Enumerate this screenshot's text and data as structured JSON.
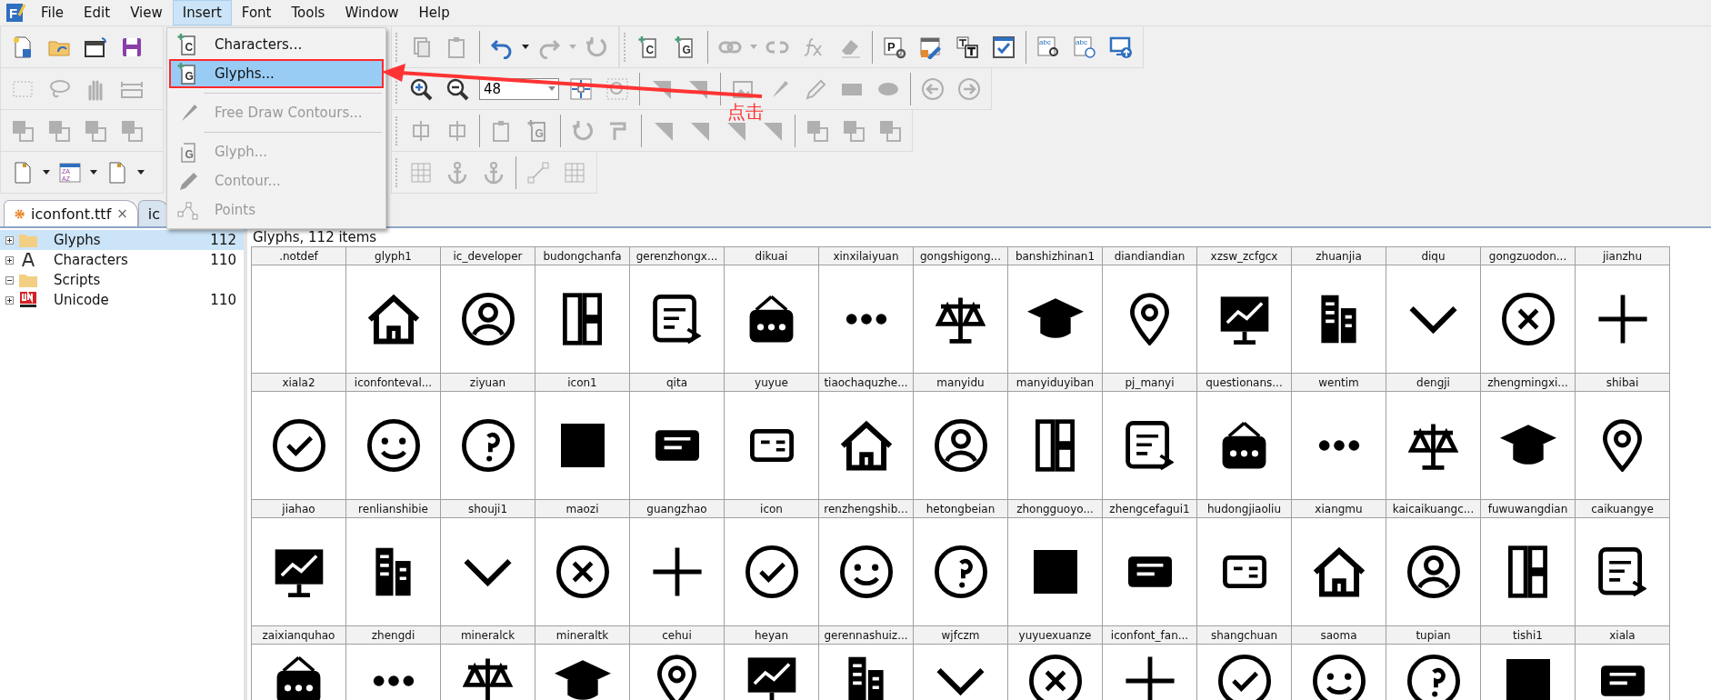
{
  "menu_bar": {
    "logo_letter": "F",
    "items": [
      {
        "label": "File",
        "selected": false
      },
      {
        "label": "Edit",
        "selected": false
      },
      {
        "label": "View",
        "selected": false
      },
      {
        "label": "Insert",
        "selected": true
      },
      {
        "label": "Font",
        "selected": false
      },
      {
        "label": "Tools",
        "selected": false
      },
      {
        "label": "Window",
        "selected": false
      },
      {
        "label": "Help",
        "selected": false
      }
    ]
  },
  "insert_menu": {
    "items": [
      {
        "kind": "add-char",
        "letter": "C",
        "label": "Characters...",
        "selected": false,
        "disabled": false,
        "outlined": false
      },
      {
        "kind": "add-glyph",
        "letter": "G",
        "label": "Glyphs...",
        "selected": true,
        "disabled": false,
        "outlined": true
      },
      {
        "kind": "separator"
      },
      {
        "kind": "draw",
        "label": "Free Draw Contours...",
        "selected": false,
        "disabled": true,
        "outlined": false
      },
      {
        "kind": "separator"
      },
      {
        "kind": "glyph",
        "letter": "G",
        "label": "Glyph...",
        "selected": false,
        "disabled": true,
        "outlined": false
      },
      {
        "kind": "contour",
        "label": "Contour...",
        "selected": false,
        "disabled": true,
        "outlined": false
      },
      {
        "kind": "points",
        "label": "Points",
        "selected": false,
        "disabled": true,
        "outlined": false
      }
    ]
  },
  "toolbars": [
    {
      "left": [
        {
          "kind": "new",
          "disabled": false
        },
        {
          "kind": "open",
          "disabled": false
        },
        {
          "kind": "font",
          "disabled": false
        },
        {
          "kind": "save",
          "disabled": false
        }
      ],
      "right": [
        {
          "kind": "copy",
          "disabled": true
        },
        {
          "kind": "paste",
          "disabled": true
        },
        {
          "kind": "sep"
        },
        {
          "kind": "undo",
          "disabled": false
        },
        {
          "kind": "caret",
          "disabled": false
        },
        {
          "kind": "redo",
          "disabled": true
        },
        {
          "kind": "caret",
          "disabled": true
        },
        {
          "kind": "reload",
          "disabled": true
        },
        {
          "kind": "strip"
        },
        {
          "kind": "add-char",
          "letter": "C",
          "disabled": false
        },
        {
          "kind": "add-glyph",
          "letter": "G",
          "disabled": false
        },
        {
          "kind": "sep"
        },
        {
          "kind": "link",
          "disabled": true
        },
        {
          "kind": "caret",
          "disabled": true
        },
        {
          "kind": "unlink",
          "disabled": true
        },
        {
          "kind": "fx",
          "disabled": true
        },
        {
          "kind": "eraser",
          "disabled": true
        },
        {
          "kind": "sep"
        },
        {
          "kind": "params",
          "letter": "P",
          "disabled": false
        },
        {
          "kind": "table",
          "disabled": false
        },
        {
          "kind": "text",
          "disabled": false
        },
        {
          "kind": "check",
          "disabled": false
        },
        {
          "kind": "sep"
        },
        {
          "kind": "spell",
          "letter": "abc",
          "disabled": false
        },
        {
          "kind": "web",
          "letter": "abc",
          "disabled": false
        },
        {
          "kind": "upload",
          "disabled": false
        }
      ]
    },
    {
      "left": [
        {
          "kind": "select",
          "disabled": true
        },
        {
          "kind": "lasso",
          "disabled": true
        },
        {
          "kind": "hand",
          "disabled": true
        },
        {
          "kind": "ruler",
          "disabled": true
        }
      ],
      "right": [
        {
          "kind": "zoom-in",
          "disabled": false
        },
        {
          "kind": "zoom-out",
          "disabled": false
        },
        {
          "kind": "zoom",
          "value": "48"
        },
        {
          "kind": "fit",
          "disabled": false
        },
        {
          "kind": "zoom-rect",
          "disabled": true
        },
        {
          "kind": "sep"
        },
        {
          "kind": "triangle",
          "disabled": true
        },
        {
          "kind": "triangle",
          "disabled": true
        },
        {
          "kind": "sep"
        },
        {
          "kind": "image",
          "disabled": true
        },
        {
          "kind": "brush",
          "disabled": true
        },
        {
          "kind": "pencil",
          "disabled": true
        },
        {
          "kind": "rectangle",
          "disabled": true
        },
        {
          "kind": "ellipse",
          "disabled": true
        },
        {
          "kind": "sep"
        },
        {
          "kind": "prev",
          "disabled": true
        },
        {
          "kind": "next",
          "disabled": true
        }
      ]
    },
    {
      "left": [
        {
          "kind": "overlap",
          "disabled": true
        },
        {
          "kind": "overlap",
          "disabled": true
        },
        {
          "kind": "overlap",
          "disabled": true
        },
        {
          "kind": "overlap",
          "disabled": true
        }
      ],
      "right": [
        {
          "kind": "align",
          "disabled": true
        },
        {
          "kind": "align",
          "disabled": true
        },
        {
          "kind": "sep"
        },
        {
          "kind": "paste",
          "disabled": true
        },
        {
          "kind": "add-glyph",
          "letter": "G",
          "disabled": true
        },
        {
          "kind": "sep"
        },
        {
          "kind": "reload",
          "disabled": true
        },
        {
          "kind": "clamp",
          "disabled": true
        },
        {
          "kind": "sep"
        },
        {
          "kind": "triangle",
          "disabled": true
        },
        {
          "kind": "triangle",
          "disabled": true
        },
        {
          "kind": "triangle",
          "disabled": true
        },
        {
          "kind": "triangle",
          "disabled": true
        },
        {
          "kind": "sep"
        },
        {
          "kind": "overlap",
          "disabled": true
        },
        {
          "kind": "overlap",
          "disabled": true
        },
        {
          "kind": "overlap",
          "disabled": true
        }
      ]
    },
    {
      "left": [
        {
          "kind": "page",
          "disabled": false
        },
        {
          "kind": "caret",
          "disabled": false
        },
        {
          "kind": "sort",
          "letter": "ZA",
          "letter2": "AZ",
          "disabled": false
        },
        {
          "kind": "caret",
          "disabled": false
        },
        {
          "kind": "page",
          "disabled": false
        },
        {
          "kind": "caret",
          "disabled": false
        }
      ],
      "right": [
        {
          "kind": "grid",
          "disabled": true
        },
        {
          "kind": "anchor",
          "disabled": true
        },
        {
          "kind": "anchor",
          "disabled": true
        },
        {
          "kind": "sep"
        },
        {
          "kind": "node",
          "disabled": true
        },
        {
          "kind": "grid",
          "disabled": true
        }
      ]
    }
  ],
  "tabs": [
    {
      "label": "iconfont.ttf",
      "selected": true,
      "close": "×"
    },
    {
      "label": "ic",
      "selected": false
    }
  ],
  "tree": {
    "items": [
      {
        "kind": "folder",
        "label": "Glyphs",
        "count": "112",
        "expanded": false,
        "selected": true
      },
      {
        "kind": "letter",
        "label": "Characters",
        "count": "110",
        "expanded": false,
        "selected": false
      },
      {
        "kind": "folder",
        "label": "Scripts",
        "expanded": true,
        "selected": false
      },
      {
        "kind": "unicode",
        "label": "Unicode",
        "count": "110",
        "expanded": false,
        "selected": false
      }
    ]
  },
  "glyph_view": {
    "title": "Glyphs, 112 items",
    "glyphs": [
      {
        "name": ".notdef",
        "blank": true
      },
      {
        "name": "glyph1",
        "blank": false
      },
      {
        "name": "ic_developer",
        "blank": false
      },
      {
        "name": "budongchanfa",
        "blank": false
      },
      {
        "name": "gerenzhongx...",
        "blank": false
      },
      {
        "name": "dikuai",
        "blank": false
      },
      {
        "name": "xinxilaiyuan",
        "blank": false
      },
      {
        "name": "gongshigong...",
        "blank": false
      },
      {
        "name": "banshizhinan1",
        "blank": false
      },
      {
        "name": "diandiandian",
        "blank": false
      },
      {
        "name": "xzsw_zcfgcx",
        "blank": false
      },
      {
        "name": "zhuanjia",
        "blank": false
      },
      {
        "name": "diqu",
        "blank": false
      },
      {
        "name": "gongzuodon...",
        "blank": false
      },
      {
        "name": "jianzhu",
        "blank": false
      },
      {
        "name": "xiala2",
        "blank": false
      },
      {
        "name": "iconfonteval...",
        "blank": false
      },
      {
        "name": "ziyuan",
        "blank": false
      },
      {
        "name": "icon1",
        "blank": false
      },
      {
        "name": "qita",
        "blank": false
      },
      {
        "name": "yuyue",
        "blank": false
      },
      {
        "name": "tiaochaquzhe...",
        "blank": false
      },
      {
        "name": "manyidu",
        "blank": false
      },
      {
        "name": "manyiduyiban",
        "blank": false
      },
      {
        "name": "pj_manyi",
        "blank": false
      },
      {
        "name": "questionans...",
        "blank": false
      },
      {
        "name": "wentim",
        "blank": false
      },
      {
        "name": "dengji",
        "blank": false
      },
      {
        "name": "zhengmingxi...",
        "blank": false
      },
      {
        "name": "shibai",
        "blank": false
      },
      {
        "name": "jiahao",
        "blank": false
      },
      {
        "name": "renlianshibie",
        "blank": false
      },
      {
        "name": "shouji1",
        "blank": false
      },
      {
        "name": "maozi",
        "blank": false
      },
      {
        "name": "guangzhao",
        "blank": false
      },
      {
        "name": "icon",
        "blank": false
      },
      {
        "name": "renzhengshib...",
        "blank": false
      },
      {
        "name": "hetongbeian",
        "blank": false
      },
      {
        "name": "zhongguoyo...",
        "blank": false
      },
      {
        "name": "zhengcefagui1",
        "blank": false
      },
      {
        "name": "hudongjiaoliu",
        "blank": false
      },
      {
        "name": "xiangmu",
        "blank": false
      },
      {
        "name": "kaicaikuangc...",
        "blank": false
      },
      {
        "name": "fuwuwangdian",
        "blank": false
      },
      {
        "name": "caikuangye",
        "blank": false
      },
      {
        "name": "zaixianquhao",
        "blank": false
      },
      {
        "name": "zhengdi",
        "blank": false
      },
      {
        "name": "mineralck",
        "blank": false
      },
      {
        "name": "mineraltk",
        "blank": false
      },
      {
        "name": "cehui",
        "blank": false
      },
      {
        "name": "heyan",
        "blank": false
      },
      {
        "name": "gerennashuiz...",
        "blank": false
      },
      {
        "name": "wjfczm",
        "blank": false
      },
      {
        "name": "yuyuexuanze",
        "blank": false
      },
      {
        "name": "iconfont_fan...",
        "blank": false
      },
      {
        "name": "shangchuan",
        "blank": false
      },
      {
        "name": "saoma",
        "blank": false
      },
      {
        "name": "tupian",
        "blank": false
      },
      {
        "name": "tishi1",
        "blank": false
      },
      {
        "name": "xiala",
        "blank": false
      }
    ]
  },
  "annotation": {
    "text": "点击"
  }
}
